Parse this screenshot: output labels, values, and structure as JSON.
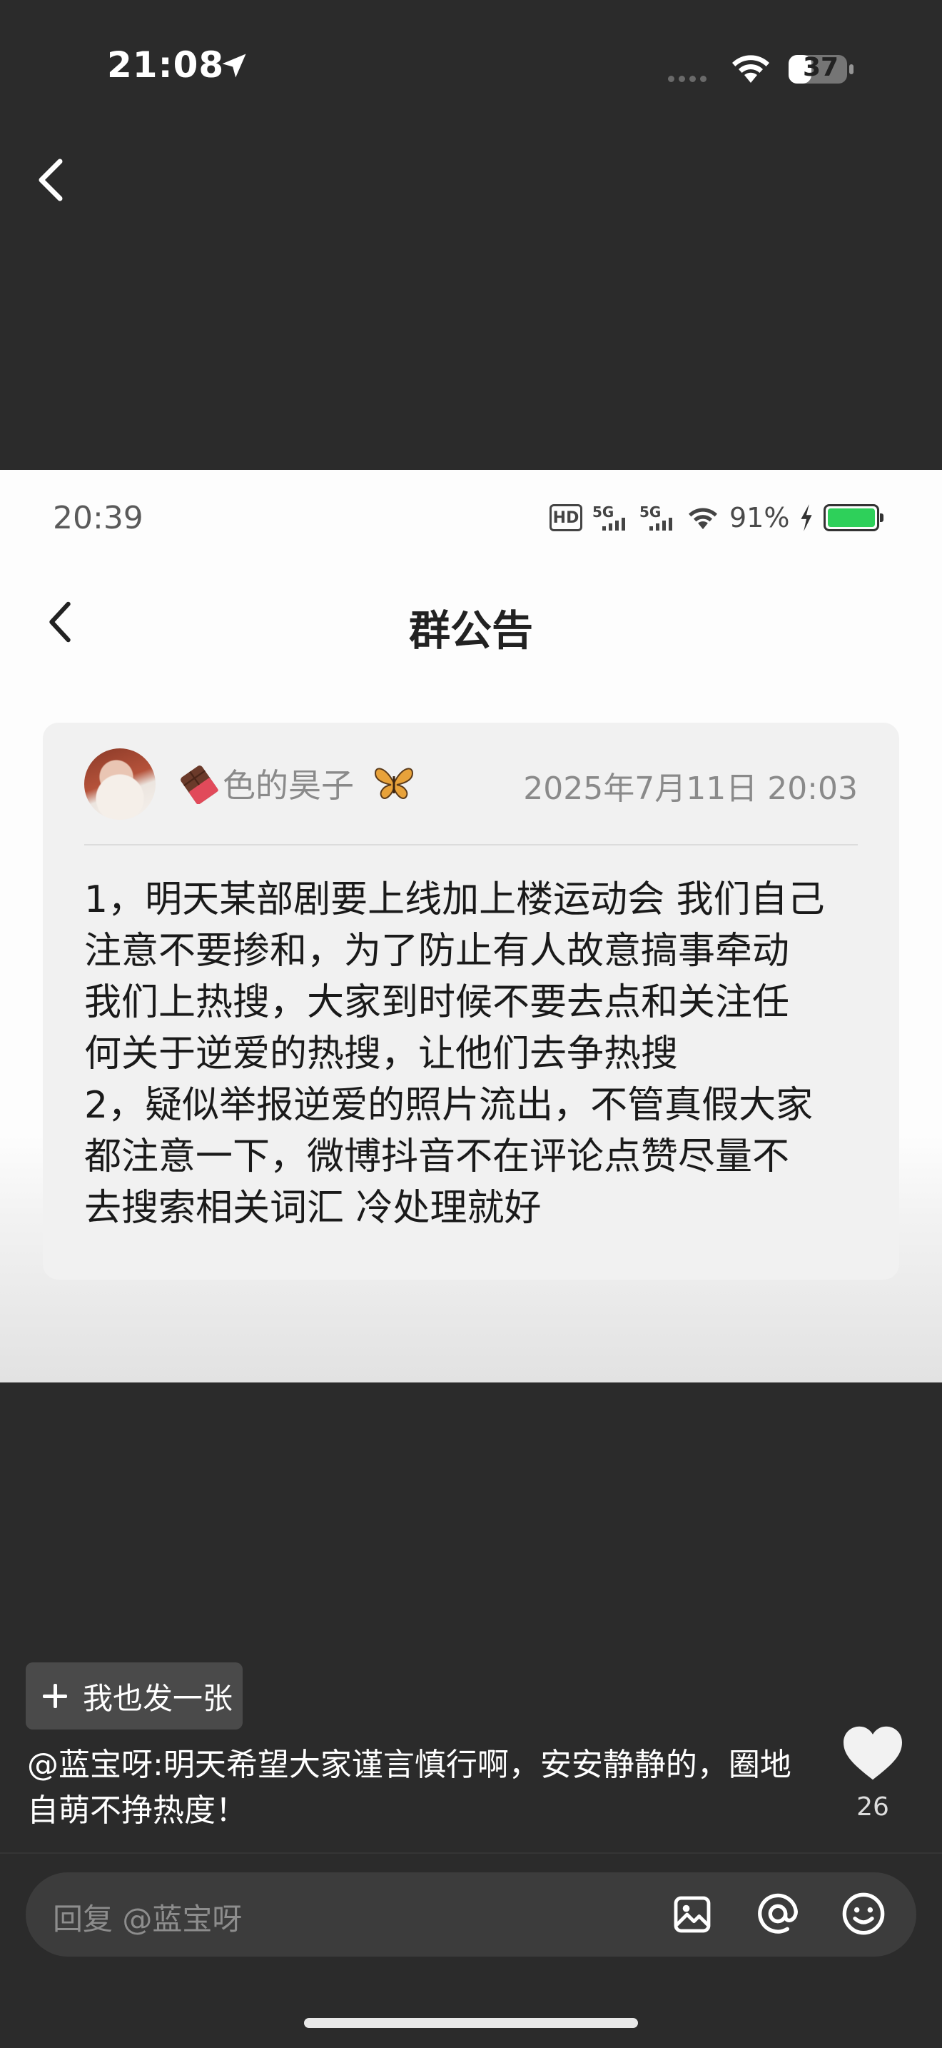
{
  "status_bar": {
    "time": "21:08",
    "battery": "37"
  },
  "screenshot": {
    "status_bar": {
      "time": "20:39",
      "battery_text": "91%",
      "hd_label": "HD",
      "network_label": "5G"
    },
    "title": "群公告",
    "announcement": {
      "author": "色的昊子",
      "datetime": "2025年7月11日 20:03",
      "lines": [
        "1，明天某部剧要上线加上楼运动会 我们自己",
        "注意不要掺和，为了防止有人故意搞事牵动",
        "我们上热搜，大家到时候不要去点和关注任",
        "何关于逆爱的热搜，让他们去争热搜",
        "2，疑似举报逆爱的照片流出，不管真假大家",
        "都注意一下，微博抖音不在评论点赞尽量不",
        "去搜索相关词汇 冷处理就好"
      ]
    }
  },
  "post_button": {
    "label": "我也发一张"
  },
  "comment": {
    "lines": [
      "@蓝宝呀:明天希望大家谨言慎行啊，安安静静的，圈地",
      "自萌不挣热度！"
    ]
  },
  "like": {
    "count": "26"
  },
  "reply_input": {
    "placeholder": "回复 @蓝宝呀"
  },
  "icons": {
    "back": "chevron-left-icon",
    "location": "location-arrow-icon",
    "wifi": "wifi-icon",
    "battery": "battery-icon",
    "heart": "heart-icon",
    "image": "image-icon",
    "mention": "at-icon",
    "emoji": "emoji-icon"
  },
  "colors": {
    "background": "#2b2b2b",
    "card": "#f1f1f1",
    "battery_green": "#2ed05a"
  }
}
